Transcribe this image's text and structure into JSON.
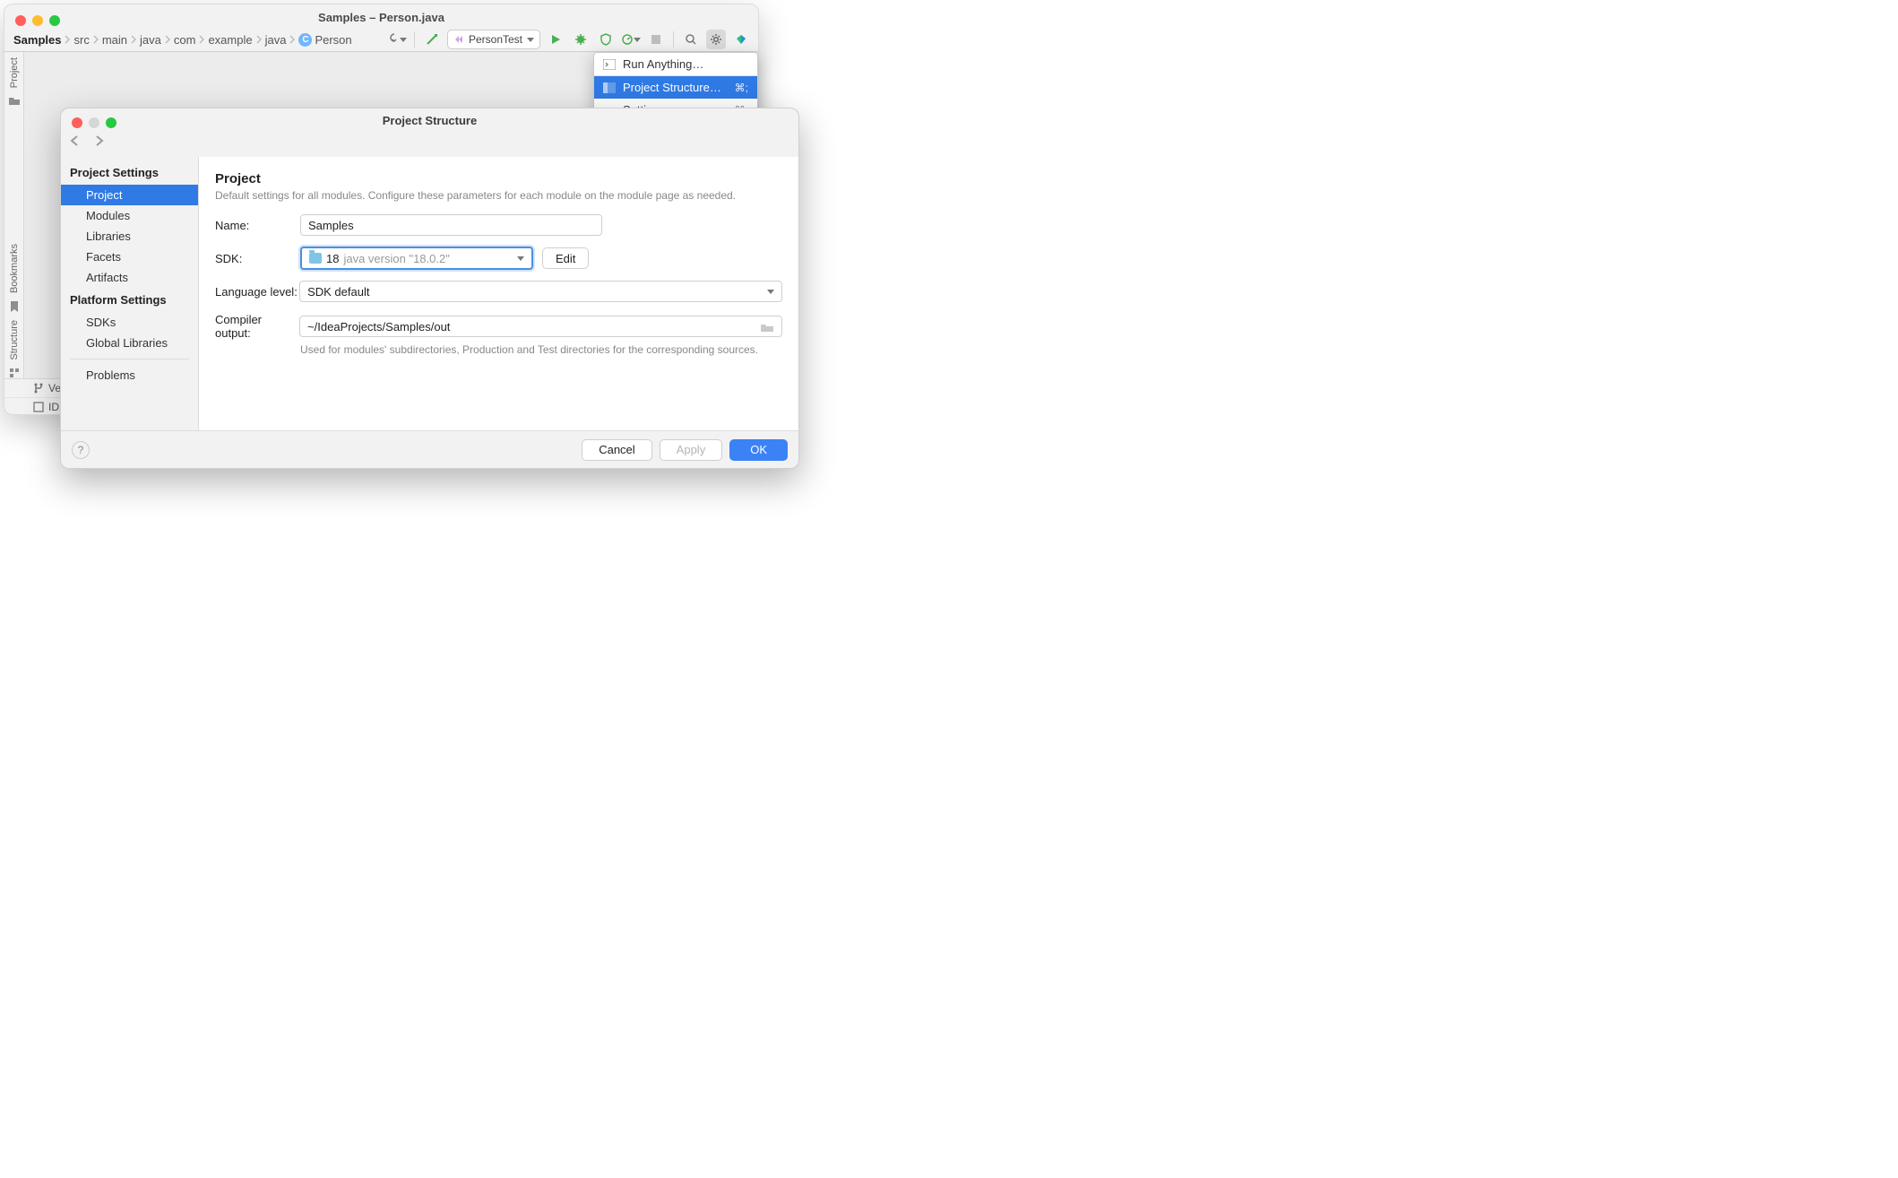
{
  "window_title": "Samples – Person.java",
  "breadcrumbs": [
    "Samples",
    "src",
    "main",
    "java",
    "com",
    "example",
    "java",
    "Person"
  ],
  "run_config": "PersonTest",
  "left_tabs": {
    "project": "Project",
    "bookmarks": "Bookmarks",
    "structure": "Structure"
  },
  "status": {
    "line1": "Versi",
    "line2": "IDE ar"
  },
  "popup": {
    "run_anything": "Run Anything…",
    "project_structure": "Project Structure…",
    "project_structure_kb": "⌘;",
    "settings": "Settings…",
    "settings_kb": "⌘,"
  },
  "dialog": {
    "title": "Project Structure",
    "side": {
      "project_settings": "Project Settings",
      "project": "Project",
      "modules": "Modules",
      "libraries": "Libraries",
      "facets": "Facets",
      "artifacts": "Artifacts",
      "platform_settings": "Platform Settings",
      "sdks": "SDKs",
      "global_libraries": "Global Libraries",
      "problems": "Problems"
    },
    "main": {
      "heading": "Project",
      "desc": "Default settings for all modules. Configure these parameters for each module on the module page as needed.",
      "name_label": "Name:",
      "name_value": "Samples",
      "sdk_label": "SDK:",
      "sdk_value_num": "18",
      "sdk_value_ver": "java version \"18.0.2\"",
      "edit": "Edit",
      "lang_label": "Language level:",
      "lang_value": "SDK default",
      "compiler_label": "Compiler output:",
      "compiler_value": "~/IdeaProjects/Samples/out",
      "compiler_hint": "Used for modules' subdirectories, Production and Test directories for the corresponding sources."
    },
    "buttons": {
      "help": "?",
      "cancel": "Cancel",
      "apply": "Apply",
      "ok": "OK"
    }
  }
}
